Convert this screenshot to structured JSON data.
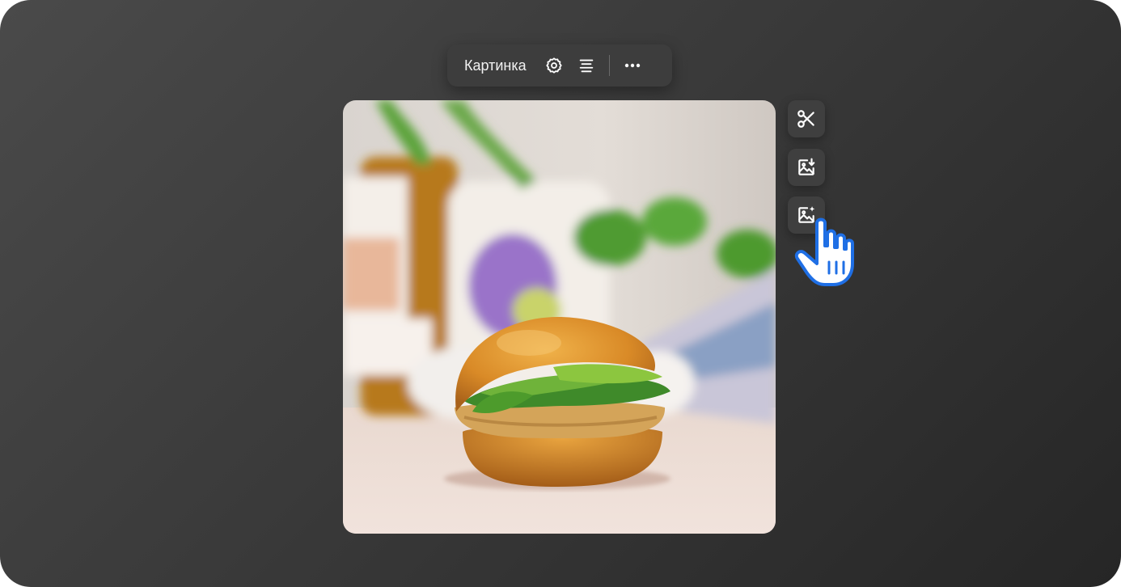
{
  "toolbar": {
    "title": "Картинка",
    "icons": {
      "settings": "gear-icon",
      "align": "align-center-icon",
      "more": "more-horizontal-icon"
    }
  },
  "image": {
    "alt": "Бургер с авокадо и зеленью на светлом столе",
    "subject": "burger-photo"
  },
  "side_actions": [
    {
      "name": "crop",
      "icon": "scissors-icon"
    },
    {
      "name": "download-image",
      "icon": "image-download-icon"
    },
    {
      "name": "ai-image",
      "icon": "image-sparkle-icon"
    }
  ],
  "cursor": {
    "icon": "hand-pointer-icon",
    "color": "#1f6fe5"
  },
  "colors": {
    "background": "#3a3a3a",
    "panel": "#3d3d3d",
    "icon": "#ffffff",
    "accent": "#1f6fe5"
  }
}
